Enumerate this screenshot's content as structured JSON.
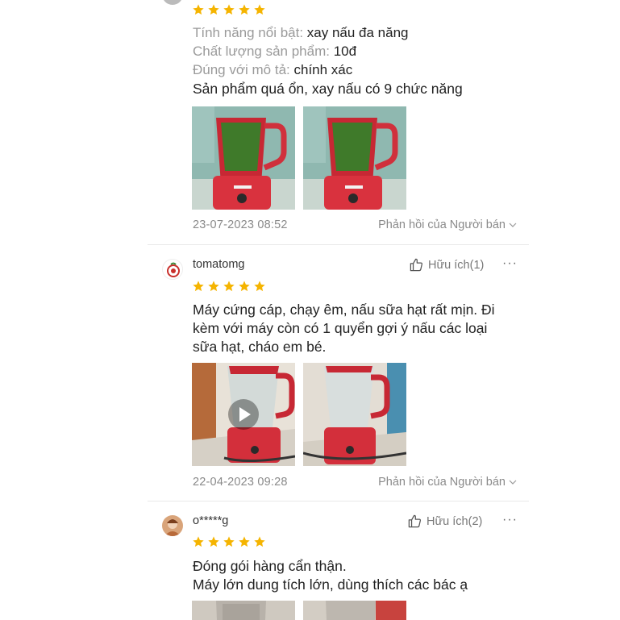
{
  "colors": {
    "star": "#f5b400",
    "muted": "#9a9a9a",
    "text": "#222222",
    "divider": "#e8e8e8"
  },
  "reviews": [
    {
      "rating": 5,
      "attributes": [
        {
          "key": "Tính năng nổi bật: ",
          "value": "xay nấu đa năng"
        },
        {
          "key": "Chất lượng sản phẩm: ",
          "value": "10đ"
        },
        {
          "key": "Đúng với mô tả: ",
          "value": "chính xác"
        }
      ],
      "text": [
        "Sản phẩm quá ổn, xay nấu có 9 chức năng"
      ],
      "media": [
        {
          "type": "image",
          "icon": "blender-green-image"
        },
        {
          "type": "image",
          "icon": "blender-green-image"
        }
      ],
      "date": "23-07-2023 08:52",
      "seller_reply_label": "Phản hồi của Người bán"
    },
    {
      "username": "tomatomg",
      "helpful_label": "Hữu ích(1)",
      "more_label": "···",
      "rating": 5,
      "text": [
        "Máy cứng cáp, chạy êm, nấu sữa hạt rất mịn. Đi",
        "kèm với máy còn có 1 quyển gợi ý nấu các loại",
        "sữa hạt, cháo em bé."
      ],
      "media": [
        {
          "type": "video",
          "icon": "play-icon"
        },
        {
          "type": "image",
          "icon": "blender-red-image"
        }
      ],
      "date": "22-04-2023 09:28",
      "seller_reply_label": "Phản hồi của Người bán"
    },
    {
      "username": "o*****g",
      "helpful_label": "Hữu ích(2)",
      "more_label": "···",
      "rating": 5,
      "text": [
        "Đóng gói hàng cẩn thận.",
        "Máy lớn dung tích lớn, dùng thích các bác ạ"
      ],
      "media": [
        {
          "type": "image",
          "icon": "blender-image"
        },
        {
          "type": "image",
          "icon": "blender-image"
        }
      ]
    }
  ]
}
